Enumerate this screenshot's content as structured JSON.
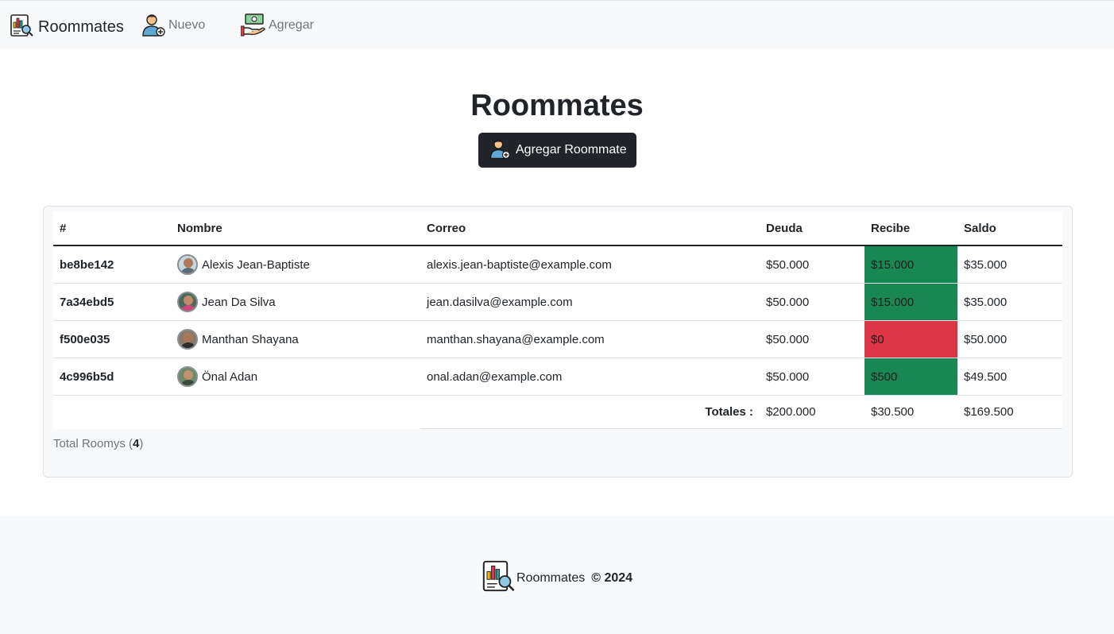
{
  "navbar": {
    "brand": "Roommates",
    "links": [
      {
        "label": "Nuevo",
        "icon": "user-add-icon"
      },
      {
        "label": "Agregar",
        "icon": "money-hand-icon"
      }
    ]
  },
  "header": {
    "title": "Roommates",
    "add_button": "Agregar Roommate"
  },
  "table": {
    "columns": [
      "#",
      "Nombre",
      "Correo",
      "Deuda",
      "Recibe",
      "Saldo"
    ],
    "rows": [
      {
        "id": "be8be142",
        "name": "Alexis Jean-Baptiste",
        "email": "alexis.jean-baptiste@example.com",
        "deuda": "$50.000",
        "recibe": "$15.000",
        "recibe_status": "positive",
        "saldo": "$35.000"
      },
      {
        "id": "7a34ebd5",
        "name": "Jean Da Silva",
        "email": "jean.dasilva@example.com",
        "deuda": "$50.000",
        "recibe": "$15.000",
        "recibe_status": "positive",
        "saldo": "$35.000"
      },
      {
        "id": "f500e035",
        "name": "Manthan Shayana",
        "email": "manthan.shayana@example.com",
        "deuda": "$50.000",
        "recibe": "$0",
        "recibe_status": "zero",
        "saldo": "$50.000"
      },
      {
        "id": "4c996b5d",
        "name": "Önal Adan",
        "email": "onal.adan@example.com",
        "deuda": "$50.000",
        "recibe": "$500",
        "recibe_status": "positive",
        "saldo": "$49.500"
      }
    ],
    "totals": {
      "label": "Totales :",
      "deuda": "$200.000",
      "recibe": "$30.500",
      "saldo": "$169.500"
    }
  },
  "summary": {
    "label": "Total Roomys",
    "count": "4"
  },
  "footer": {
    "brand": "Roommates",
    "copyright": "© 2024"
  },
  "colors": {
    "positive": "#198754",
    "zero": "#dc3545",
    "dark": "#212529",
    "light_bg": "#f8f9fa"
  }
}
